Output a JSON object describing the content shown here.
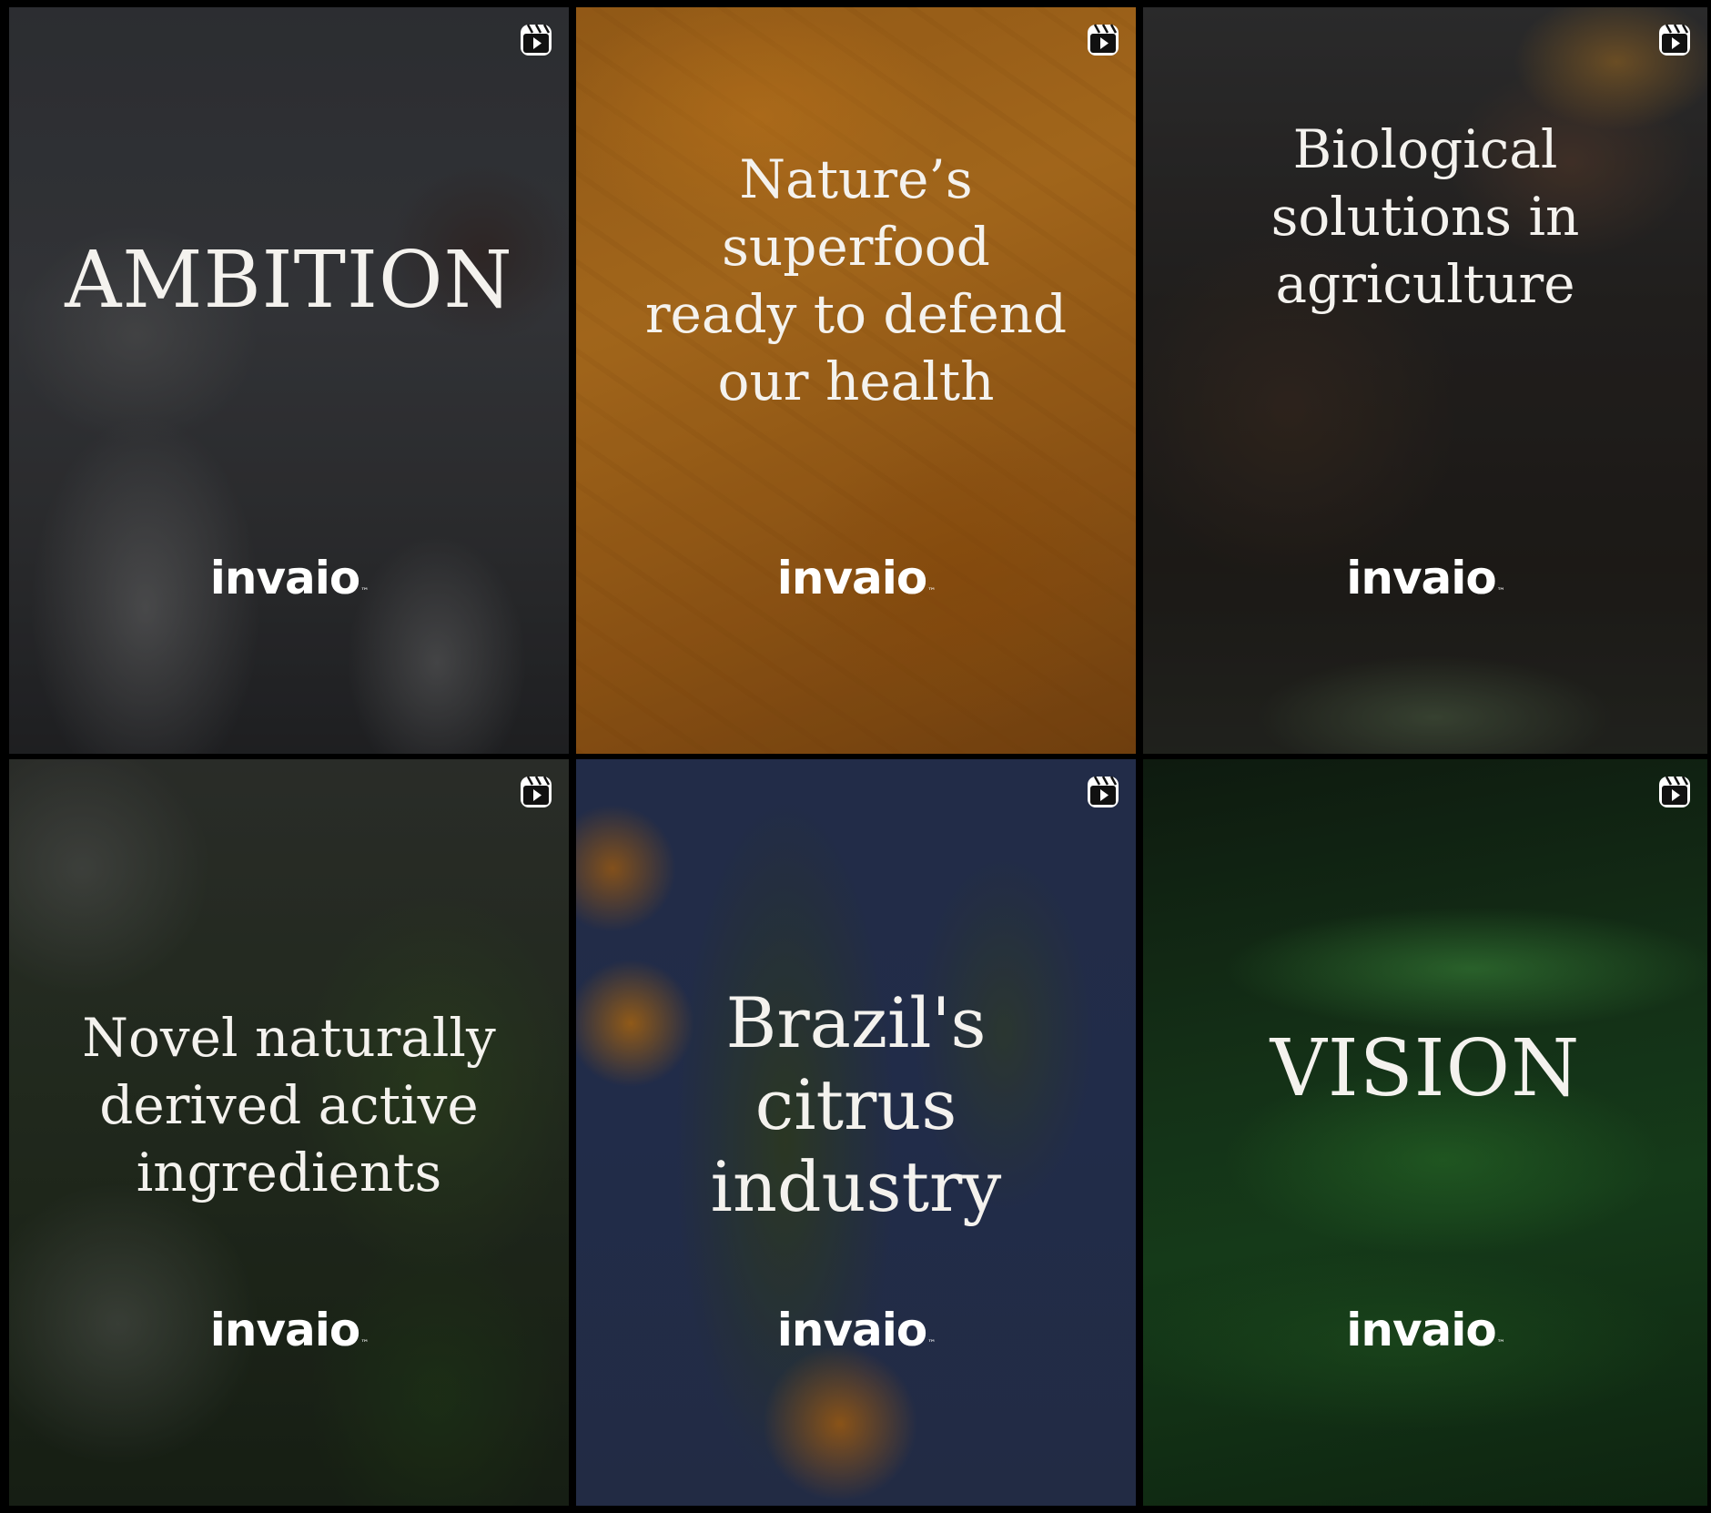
{
  "tiles": [
    {
      "headline": "AMBITION",
      "logo": "invaio",
      "tm": "™",
      "icon": "reels-icon"
    },
    {
      "headline": "Nature’s\nsuperfood\nready to defend\nour health",
      "logo": "invaio",
      "tm": "™",
      "icon": "reels-icon"
    },
    {
      "headline": "Biological\nsolutions in\nagriculture",
      "logo": "invaio",
      "tm": "™",
      "icon": "reels-icon"
    },
    {
      "headline": "Novel naturally\nderived active\ningredients",
      "logo": "invaio",
      "tm": "™",
      "icon": "reels-icon"
    },
    {
      "headline": "Brazil's\ncitrus\nindustry",
      "logo": "invaio",
      "tm": "™",
      "icon": "reels-icon"
    },
    {
      "headline": "VISION",
      "logo": "invaio",
      "tm": "™",
      "icon": "reels-icon"
    }
  ]
}
